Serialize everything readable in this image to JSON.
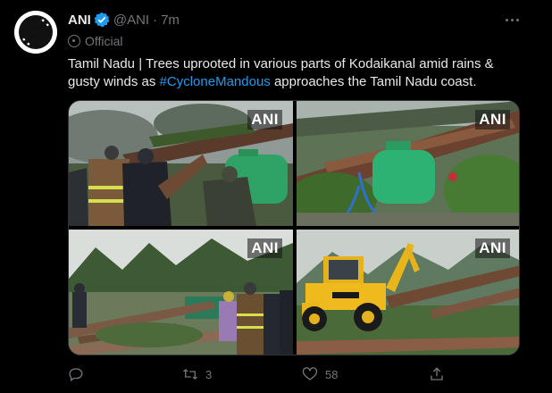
{
  "tweet": {
    "author_name": "ANI",
    "handle": "@ANI",
    "separator": "·",
    "time": "7m",
    "official_label": "Official",
    "text_before": "Tamil Nadu | Trees uprooted in various parts of  Kodaikanal amid rains & gusty winds as ",
    "hashtag": "#CycloneMandous",
    "text_after": " approaches the Tamil Nadu coast.",
    "avatar_logo_text": "ANI"
  },
  "media": {
    "photos": [
      {
        "watermark": "ANI"
      },
      {
        "watermark": "ANI"
      },
      {
        "watermark": "ANI"
      },
      {
        "watermark": "ANI"
      }
    ]
  },
  "actions": {
    "reply_count": "",
    "retweet_count": "3",
    "like_count": "58",
    "share_count": ""
  },
  "icons": {
    "verified": "verified-badge-icon",
    "more": "more-icon",
    "reply": "reply-icon",
    "retweet": "retweet-icon",
    "like": "heart-icon",
    "share": "share-icon"
  },
  "colors": {
    "background": "#000000",
    "text": "#e7e9ea",
    "muted": "#71767b",
    "accent": "#1d9bf0"
  }
}
